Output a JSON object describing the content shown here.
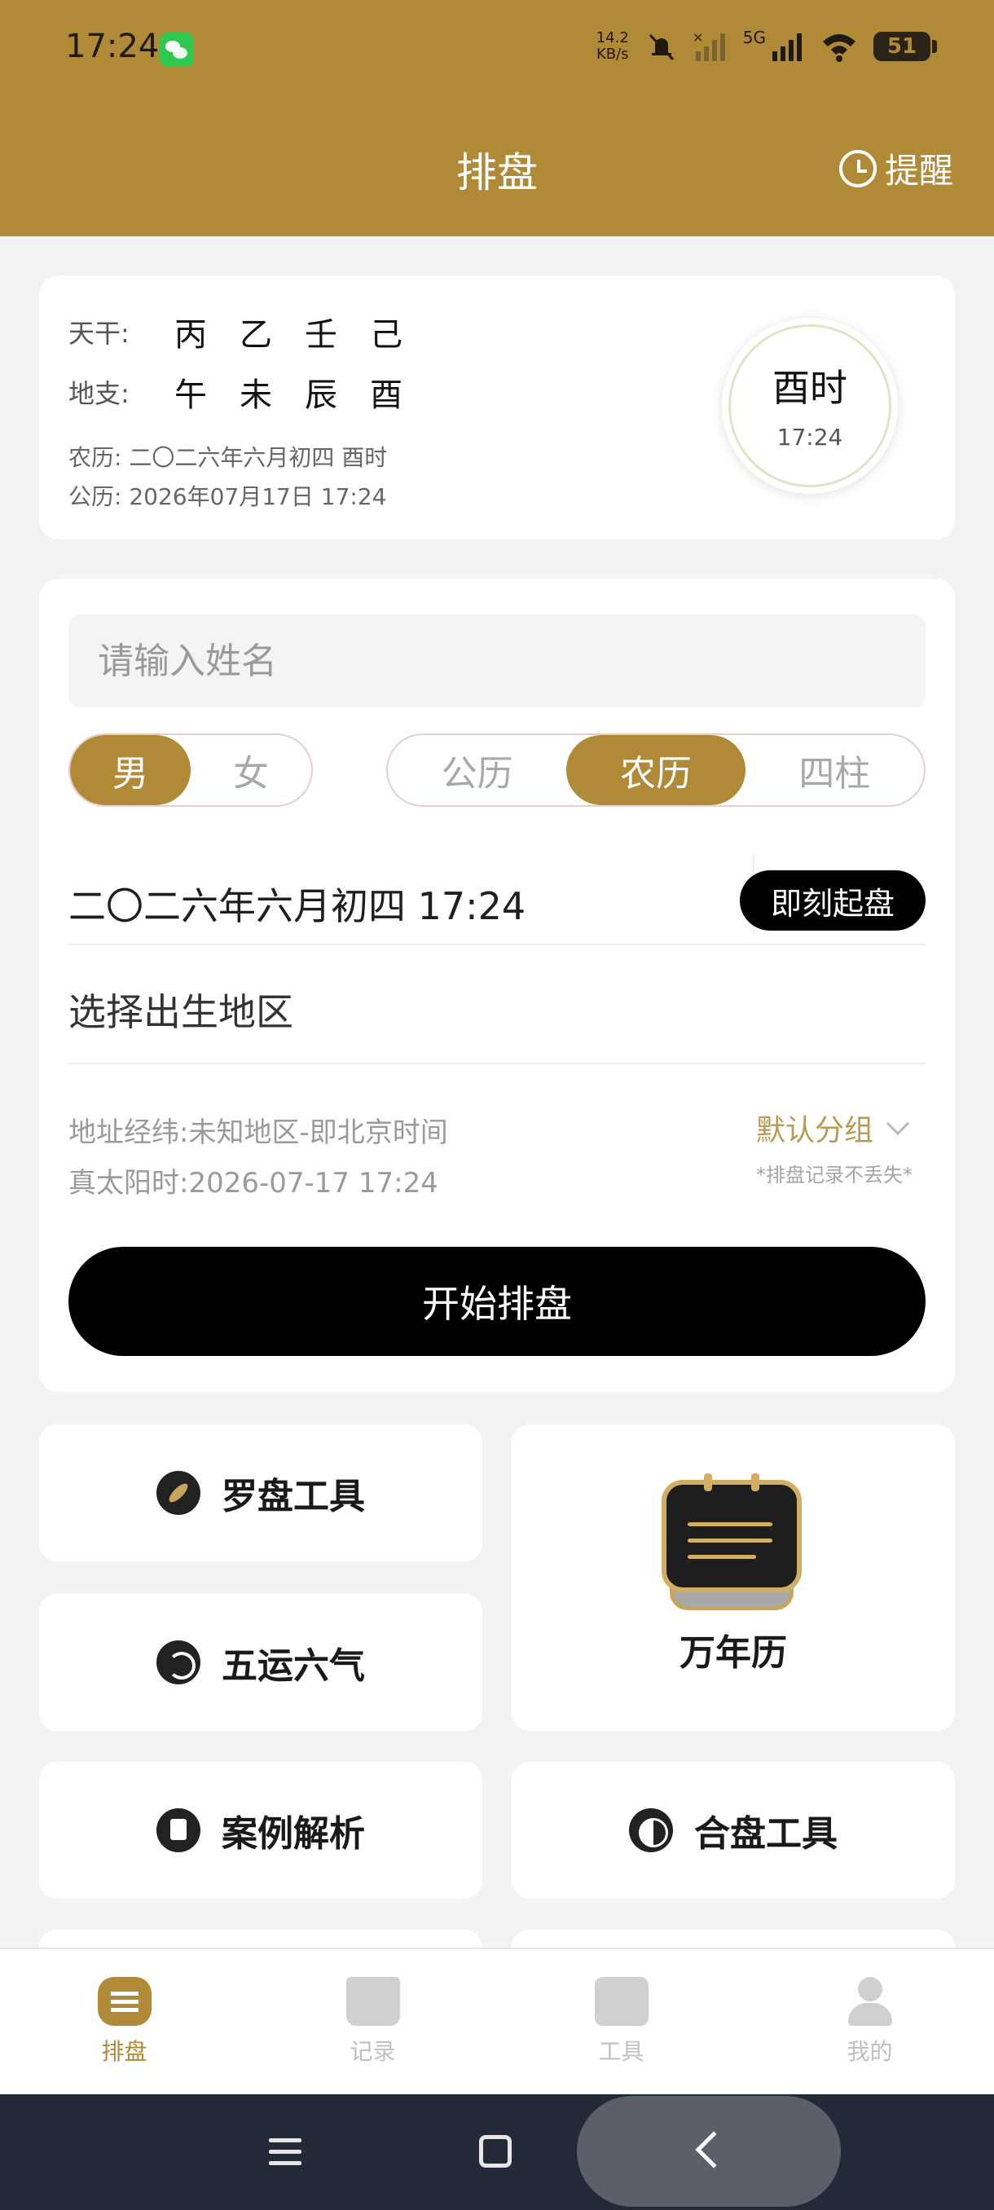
{
  "status_bar": {
    "time": "17:24",
    "net_speed_value": "14.2",
    "net_speed_unit": "KB/s",
    "network": "5G",
    "battery": "51"
  },
  "header": {
    "title": "排盘",
    "remind_label": "提醒"
  },
  "bazi": {
    "tiangan_label": "天干:",
    "tiangan": [
      "丙",
      "乙",
      "壬",
      "己"
    ],
    "dizhi_label": "地支:",
    "dizhi": [
      "午",
      "未",
      "辰",
      "酉"
    ],
    "lunar": "农历: 二〇二六年六月初四 酉时",
    "solar": "公历: 2026年07月17日 17:24",
    "clock_hour": "酉时",
    "clock_time": "17:24"
  },
  "form": {
    "name_placeholder": "请输入姓名",
    "gender_options": [
      "男",
      "女"
    ],
    "gender_selected": "男",
    "calendar_options": [
      "公历",
      "农历",
      "四柱"
    ],
    "calendar_selected": "农历",
    "date_value": "二〇二六年六月初四 17:24",
    "now_button": "即刻起盘",
    "region_placeholder": "选择出生地区",
    "address_line": "地址经纬:未知地区-即北京时间",
    "true_solar_time": "真太阳时:2026-07-17 17:24",
    "group_label": "默认分组",
    "group_note": "*排盘记录不丢失*",
    "start_button": "开始排盘"
  },
  "tools": {
    "compass": "罗盘工具",
    "wuyun": "五运六气",
    "calendar": "万年历",
    "cases": "案例解析",
    "match": "合盘工具"
  },
  "tabbar": {
    "items": [
      "排盘",
      "记录",
      "工具",
      "我的"
    ],
    "active": "排盘"
  },
  "colors": {
    "brand": "#b08a36",
    "primary_button": "#000000"
  }
}
